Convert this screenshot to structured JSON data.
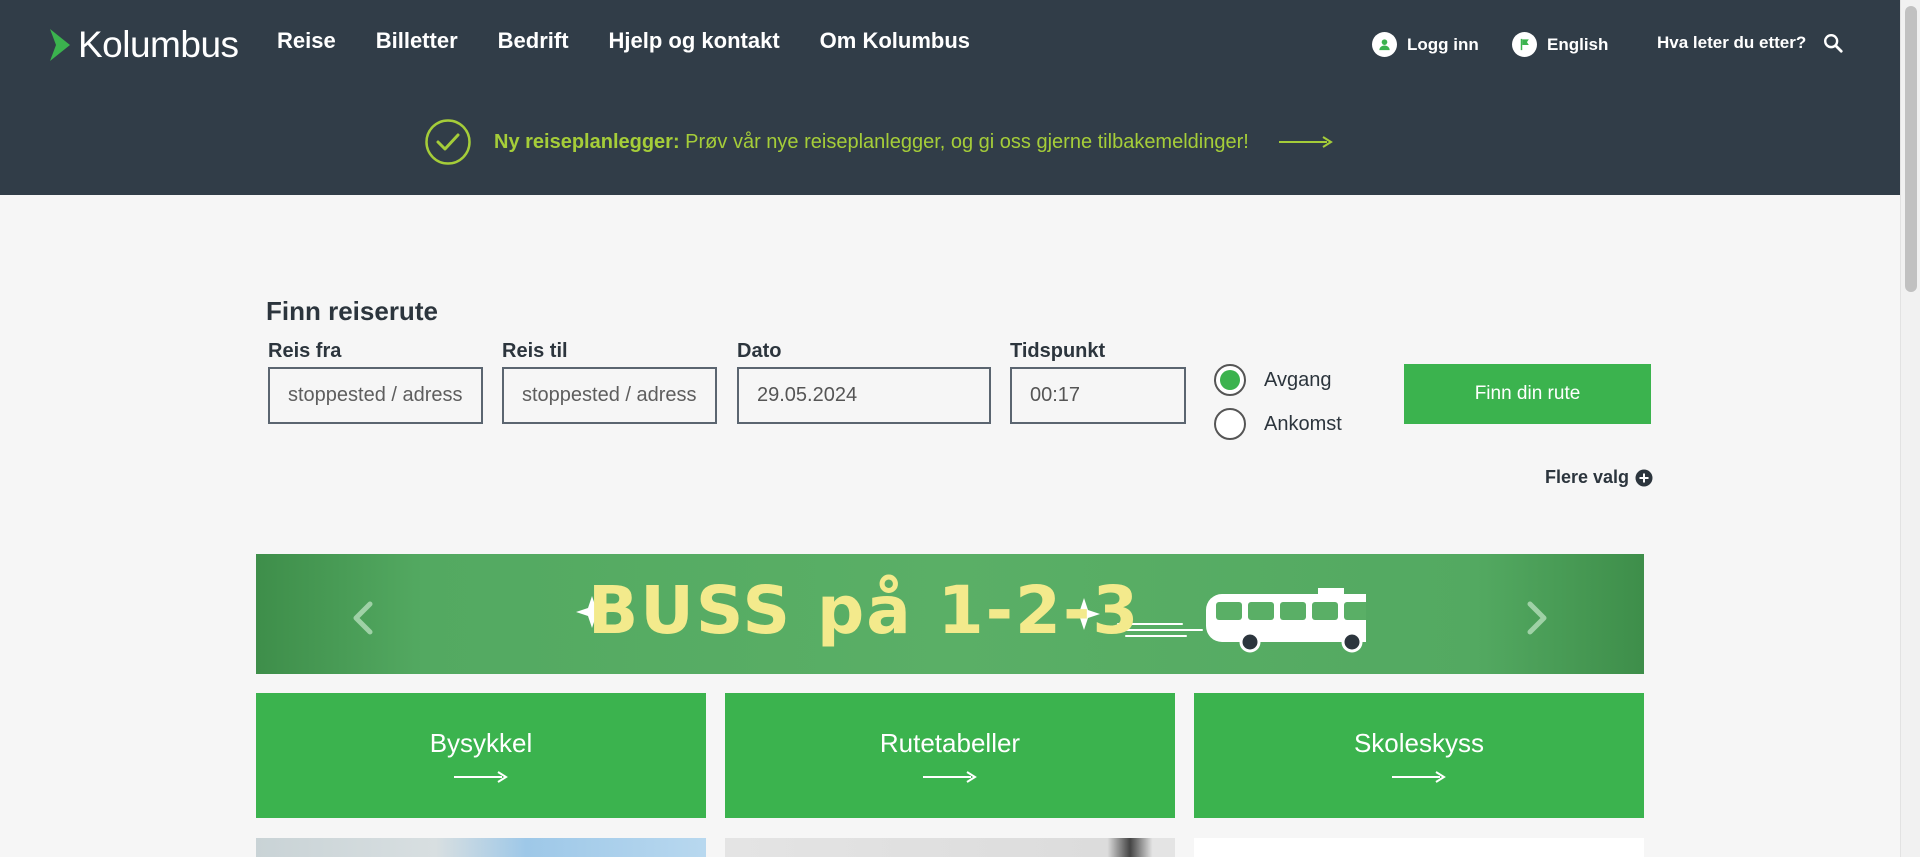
{
  "header": {
    "logo": "Kolumbus",
    "nav": [
      "Reise",
      "Billetter",
      "Bedrift",
      "Hjelp og kontakt",
      "Om Kolumbus"
    ],
    "login": "Logg inn",
    "language": "English",
    "search": "Hva leter du etter?"
  },
  "banner": {
    "title": "Ny reiseplanlegger:",
    "text": " Prøv vår nye reiseplanlegger, og gi oss gjerne tilbakemeldinger!"
  },
  "planner": {
    "title": "Finn reiserute",
    "from_label": "Reis fra",
    "from_placeholder": "stoppested / adresse",
    "to_label": "Reis til",
    "to_placeholder": "stoppested / adresse",
    "date_label": "Dato",
    "date_value": "29.05.2024",
    "time_label": "Tidspunkt",
    "time_value": "00:17",
    "departure": "Avgang",
    "arrival": "Ankomst",
    "departure_selected": true,
    "submit": "Finn din rute",
    "more_options": "Flere valg"
  },
  "carousel": {
    "slide_text": "BUSS på 1-2-3"
  },
  "tiles": [
    "Bysykkel",
    "Rutetabeller",
    "Skoleskyss"
  ],
  "colors": {
    "header_bg": "#313d48",
    "accent_green": "#3bb34e",
    "banner_text": "#a5cd39",
    "slide_text": "#f3ea8c"
  },
  "icons": [
    "logo-chevron-icon",
    "user-icon",
    "flag-icon",
    "search-icon",
    "check-circle-icon",
    "arrow-right-icon",
    "plus-circle-icon",
    "chevron-left-icon",
    "chevron-right-icon",
    "bus-icon",
    "sparkle-icon"
  ]
}
